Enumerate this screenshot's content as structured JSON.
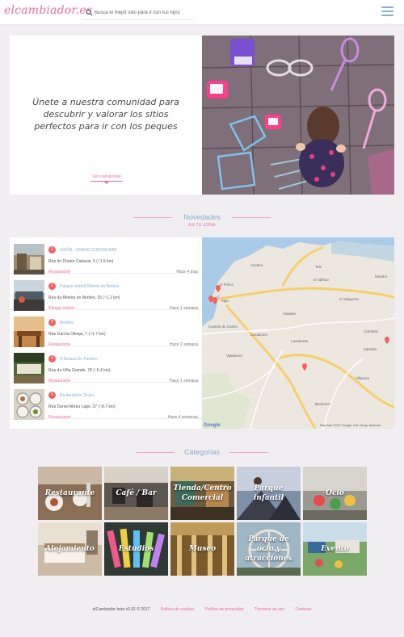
{
  "header": {
    "logo": "elcambiador",
    "logo_tld": ".es",
    "search_placeholder": "Busca el mejor sitio para ir con tus hijos"
  },
  "hero": {
    "title": "Únete a nuestra comunidad para descubrir y valorar los sitios perfectos para ir con los peques",
    "link": "Ver categorías"
  },
  "novedades": {
    "title": "Novedades",
    "subtitle": "EN TU ZONA",
    "items": [
      {
        "num": "1",
        "name": "SIFÓN - URBAN COFFEE BAR",
        "address": "Rúa do Doutor Cadaval, 5 (~1.5 km)",
        "category": "Restaurante",
        "time": "Hace 4 días"
      },
      {
        "num": "2",
        "name": "Parque infantil Ribeira do Berbés",
        "address": "Rúa da Ribeira do Berbés, 35 (~1.2 km)",
        "category": "Parque infantil",
        "time": "Hace 1 semana"
      },
      {
        "num": "3",
        "name": "Betabia",
        "address": "Rúa García Olloqui, 7 (~1.7 km)",
        "category": "Restaurante",
        "time": "Hace 1 semana"
      },
      {
        "num": "4",
        "name": "A Buraca Do Pantero",
        "address": "Rúa da Viña Grande, 78 (~5.4 km)",
        "category": "Restaurante",
        "time": "Hace 1 semana"
      },
      {
        "num": "5",
        "name": "Restaurante Ta-jeu",
        "address": "Rúa Daniel Abreu Lago, 37 (~8.7 km)",
        "category": "Restaurante",
        "time": "Hace 4 semanas"
      }
    ],
    "map": {
      "labels": [
        "Teis",
        "Vigo",
        "Castelo do Castro",
        "Lavadores",
        "O Sáiñoo",
        "O Salgueiro",
        "Bembrive",
        "Zamáns",
        "Valadares",
        "Vixiador",
        "Lavadores",
        "Candeán",
        "Alcabre",
        "Mirador",
        "Villaraxo",
        "O Frisco"
      ],
      "attribution": "Map data ©2017 Google, Inst. Geogr. Nacional",
      "google": "Google"
    }
  },
  "categorias": {
    "title": "Categorías",
    "items": [
      {
        "label": "Restaurante"
      },
      {
        "label": "Café / Bar"
      },
      {
        "label": "Tienda/Centro Comercial"
      },
      {
        "label": "Parque infantil"
      },
      {
        "label": "Ocio"
      },
      {
        "label": "Alojamiento"
      },
      {
        "label": "Estudios"
      },
      {
        "label": "Museo"
      },
      {
        "label": "Parque de ocio y atracciones"
      },
      {
        "label": "Evento"
      }
    ]
  },
  "footer": {
    "copyright": "elCambiador beta v0.92 © 2017",
    "links": [
      "Política de cookies",
      "Política de privacidad",
      "Términos de uso",
      "Contacto"
    ]
  }
}
